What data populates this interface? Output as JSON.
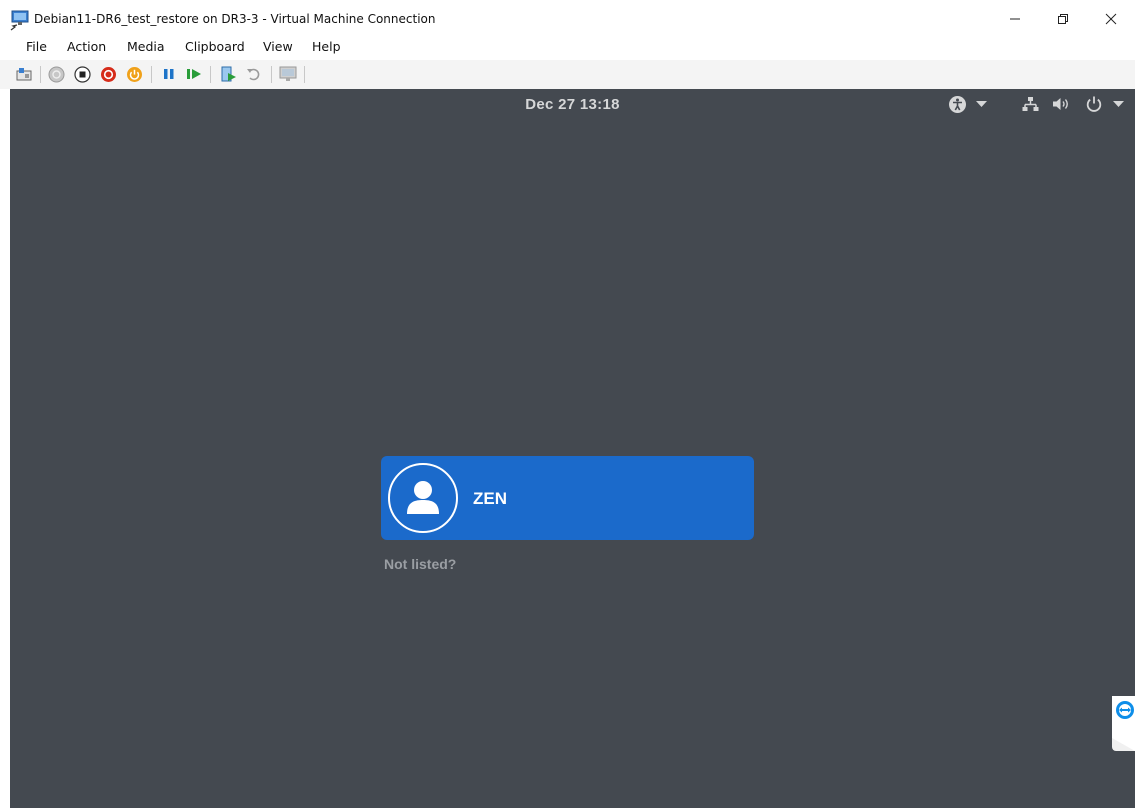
{
  "window": {
    "title": "Debian11-DR6_test_restore on DR3-3 - Virtual Machine Connection"
  },
  "menu": {
    "items": [
      "File",
      "Action",
      "Media",
      "Clipboard",
      "View",
      "Help"
    ]
  },
  "toolbar": {
    "buttons": [
      "ctrl-alt-del-icon",
      "start-icon",
      "turn-off-icon",
      "shut-down-icon",
      "save-state-icon",
      "pause-icon",
      "resume-icon",
      "checkpoint-icon",
      "revert-icon",
      "enhanced-session-icon"
    ]
  },
  "vm": {
    "clock": "Dec 27  13:18",
    "background": "#444950",
    "accent": "#1b6acb",
    "user": {
      "name": "ZEN"
    },
    "not_listed": "Not listed?"
  }
}
